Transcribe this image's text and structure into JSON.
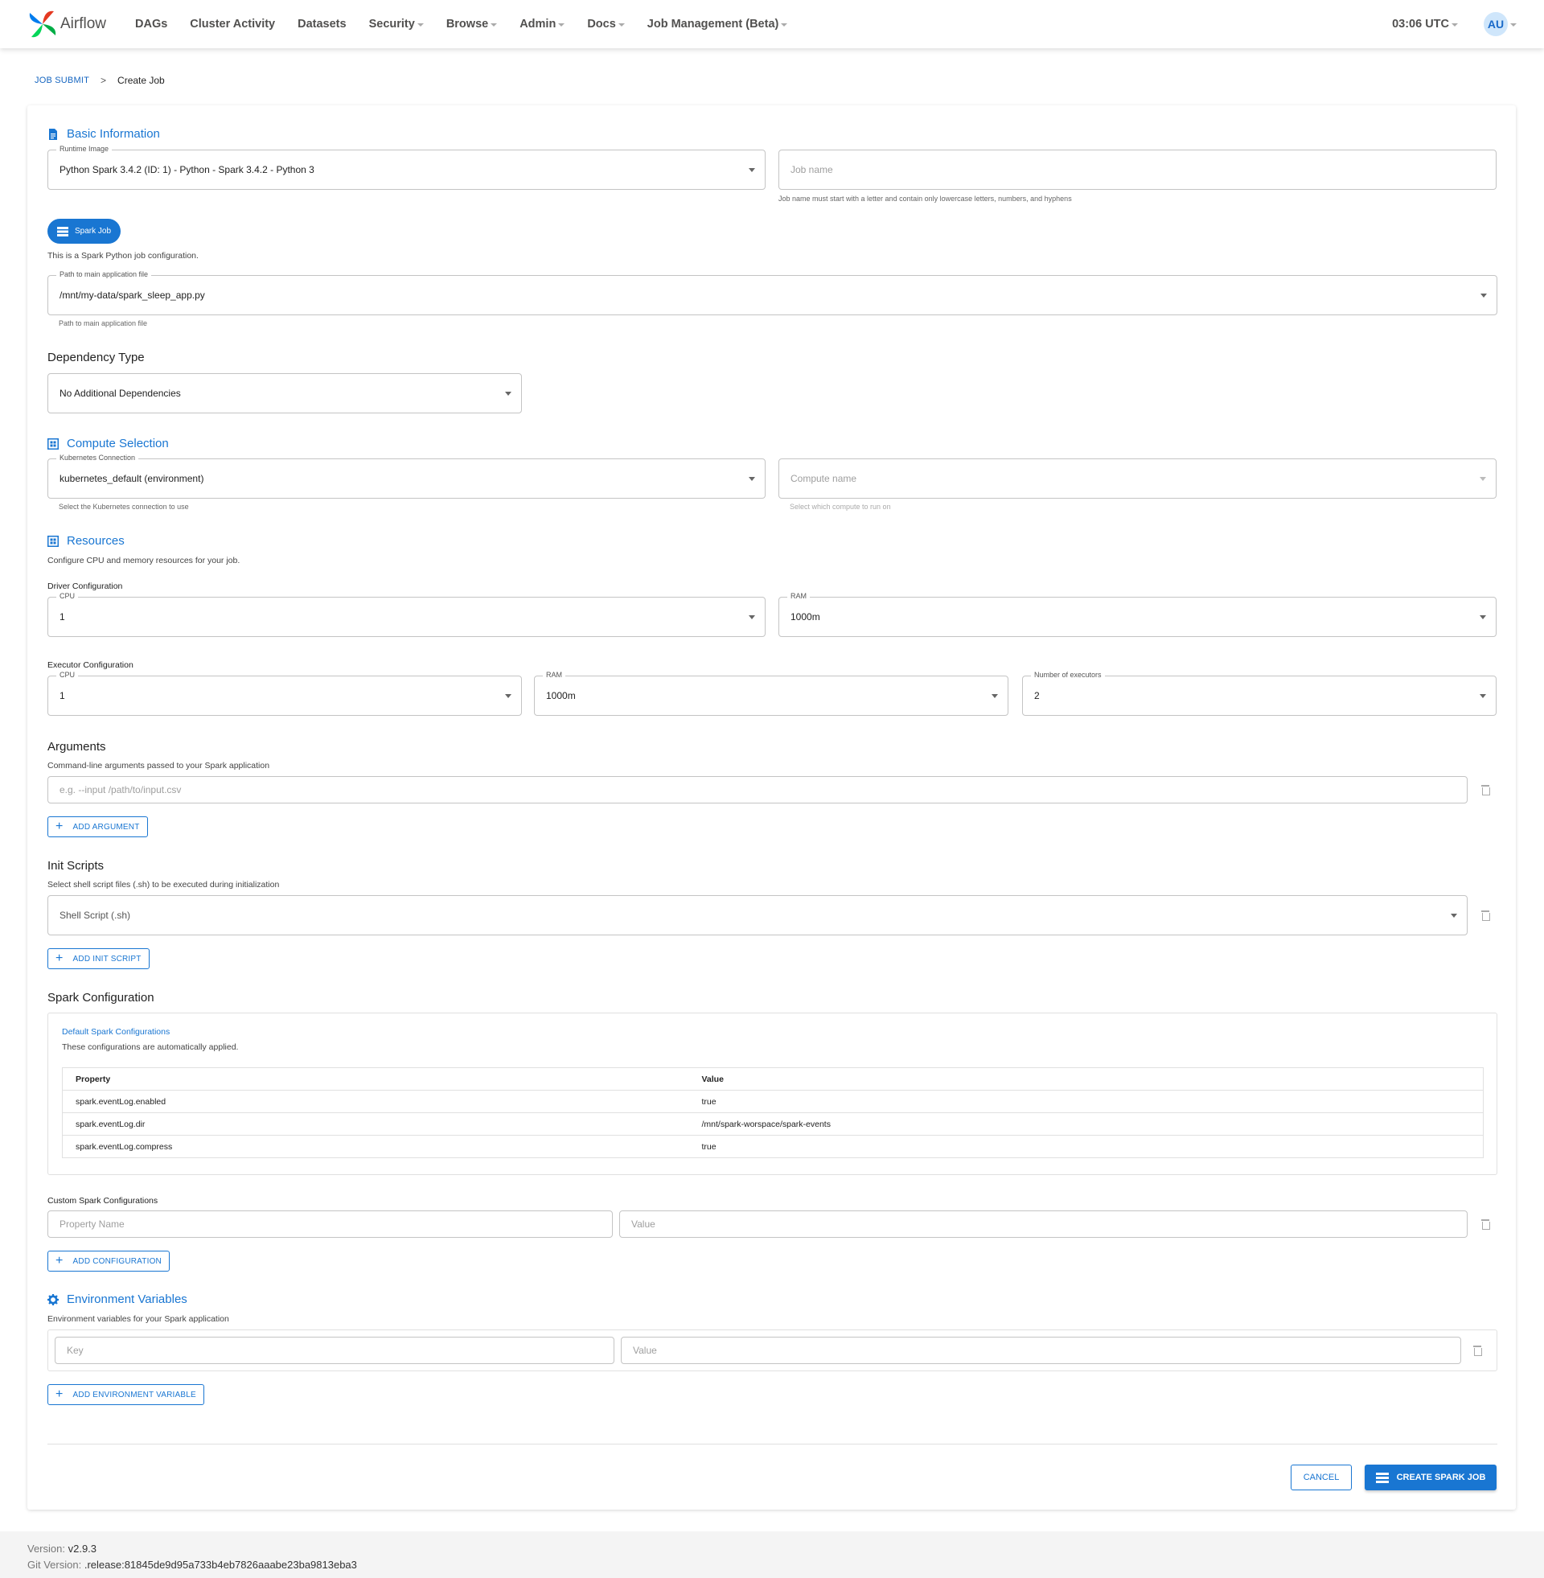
{
  "nav": {
    "brand": "Airflow",
    "links": [
      {
        "label": "DAGs",
        "caret": false
      },
      {
        "label": "Cluster Activity",
        "caret": false
      },
      {
        "label": "Datasets",
        "caret": false
      },
      {
        "label": "Security",
        "caret": true
      },
      {
        "label": "Browse",
        "caret": true
      },
      {
        "label": "Admin",
        "caret": true
      },
      {
        "label": "Docs",
        "caret": true
      },
      {
        "label": "Job Management (Beta)",
        "caret": true
      }
    ],
    "time": "03:06 UTC",
    "avatar": "AU"
  },
  "breadcrumb": {
    "parent": "JOB SUBMIT",
    "separator": ">",
    "current": "Create Job"
  },
  "basic": {
    "title": "Basic Information",
    "runtime_label": "Runtime Image",
    "runtime_value": "Python Spark 3.4.2 (ID: 1) - Python - Spark 3.4.2 - Python 3",
    "jobname_placeholder": "Job name",
    "jobname_help": "Job name must start with a letter and contain only lowercase letters, numbers, and hyphens",
    "spark_job_pill": "Spark Job",
    "description": "This is a Spark Python job configuration.",
    "path_label": "Path to main application file",
    "path_value": "/mnt/my-data/spark_sleep_app.py",
    "path_help": "Path to main application file"
  },
  "dependency": {
    "title": "Dependency Type",
    "value": "No Additional Dependencies"
  },
  "compute": {
    "title": "Compute Selection",
    "k8s_label": "Kubernetes Connection",
    "k8s_value": "kubernetes_default (environment)",
    "k8s_help": "Select the Kubernetes connection to use",
    "compute_placeholder": "Compute name",
    "compute_help": "Select which compute to run on"
  },
  "resources": {
    "title": "Resources",
    "description": "Configure CPU and memory resources for your job.",
    "driver_title": "Driver Configuration",
    "driver_cpu_label": "CPU",
    "driver_cpu": "1",
    "driver_ram_label": "RAM",
    "driver_ram": "1000m",
    "executor_title": "Executor Configuration",
    "executor_cpu_label": "CPU",
    "executor_cpu": "1",
    "executor_ram_label": "RAM",
    "executor_ram": "1000m",
    "executors_label": "Number of executors",
    "executors": "2"
  },
  "arguments": {
    "title": "Arguments",
    "description": "Command-line arguments passed to your Spark application",
    "placeholder": "e.g. --input /path/to/input.csv",
    "add_label": "ADD ARGUMENT"
  },
  "init_scripts": {
    "title": "Init Scripts",
    "description": "Select shell script files (.sh) to be executed during initialization",
    "placeholder": "Shell Script (.sh)",
    "add_label": "ADD INIT SCRIPT"
  },
  "spark_config": {
    "title": "Spark Configuration",
    "default_title": "Default Spark Configurations",
    "default_desc": "These configurations are automatically applied.",
    "col_property": "Property",
    "col_value": "Value",
    "rows": [
      {
        "property": "spark.eventLog.enabled",
        "value": "true"
      },
      {
        "property": "spark.eventLog.dir",
        "value": "/mnt/spark-worspace/spark-events"
      },
      {
        "property": "spark.eventLog.compress",
        "value": "true"
      }
    ],
    "custom_title": "Custom Spark Configurations",
    "prop_placeholder": "Property Name",
    "value_placeholder": "Value",
    "add_label": "ADD CONFIGURATION"
  },
  "env": {
    "title": "Environment Variables",
    "description": "Environment variables for your Spark application",
    "key_placeholder": "Key",
    "value_placeholder": "Value",
    "add_label": "ADD ENVIRONMENT VARIABLE"
  },
  "actions": {
    "cancel": "CANCEL",
    "create": "CREATE SPARK JOB"
  },
  "footer": {
    "version_label": "Version:",
    "version": "v2.9.3",
    "git_label": "Git Version:",
    "git": ".release:81845de9d95a733b4eb7826aaabe23ba9813eba3"
  },
  "colors": {
    "accent": "#1976d2",
    "nav_text": "#51504f"
  }
}
